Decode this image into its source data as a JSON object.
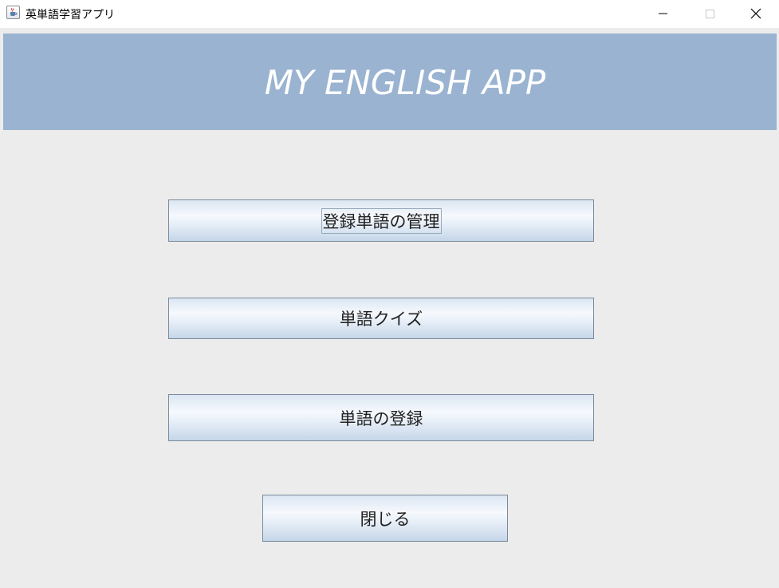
{
  "window": {
    "title": "英単語学習アプリ",
    "icon": "java-cup-icon",
    "controls": [
      "minimize-icon",
      "maximize-icon",
      "close-icon"
    ]
  },
  "header": {
    "title": "MY ENGLISH APP",
    "background": "#9ab3d1",
    "text_color": "#ffffff"
  },
  "menu": {
    "manage_label": "登録単語の管理",
    "quiz_label": "単語クイズ",
    "register_label": "単語の登録",
    "close_label": "閉じる"
  },
  "colors": {
    "window_bg": "#ececec",
    "button_border": "#7a8a9c"
  }
}
